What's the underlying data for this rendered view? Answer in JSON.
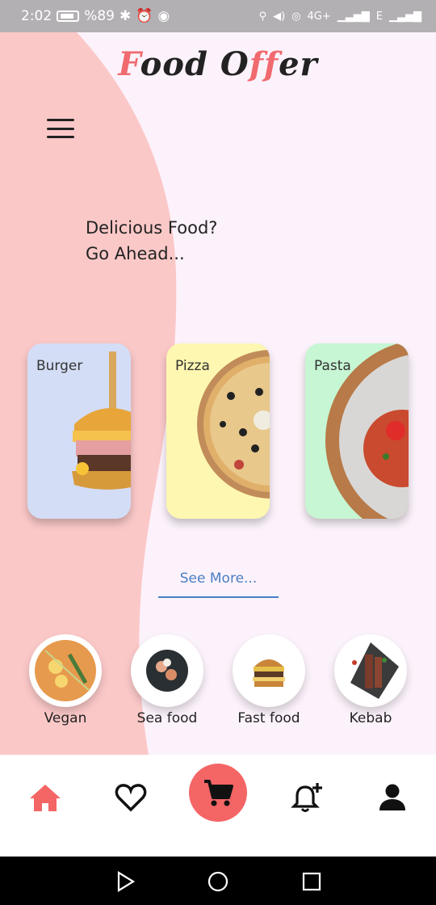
{
  "status_bar": {
    "time": "2:02",
    "battery": "%89",
    "network_label": "4G+",
    "signal2_label": "E"
  },
  "app": {
    "logo_part1": "F",
    "logo_part2": "ood O",
    "logo_part3": "ff",
    "logo_part4": "er",
    "brand_color": "#f06a6f"
  },
  "header": {
    "menu_icon": "hamburger-menu-icon"
  },
  "tagline": {
    "line1": "Delicious Food?",
    "line2": "Go Ahead..."
  },
  "food_cards": [
    {
      "label": "Burger",
      "bg_color": "#d3ddf6",
      "image": "burger-image"
    },
    {
      "label": "Pizza",
      "bg_color": "#fdf7b1",
      "image": "pizza-image"
    },
    {
      "label": "Pasta",
      "bg_color": "#c6f6d3",
      "image": "pasta-image"
    }
  ],
  "see_more_label": "See More...",
  "categories": [
    {
      "name": "Vegan",
      "image": "vegan-ramen-image"
    },
    {
      "name": "Sea food",
      "image": "seafood-image"
    },
    {
      "name": "Fast food",
      "image": "fastfood-burger-image"
    },
    {
      "name": "Kebab",
      "image": "kebab-image"
    }
  ],
  "bottom_nav": {
    "items": [
      "home-icon",
      "heart-icon",
      "cart-icon",
      "notification-add-icon",
      "profile-icon"
    ],
    "active_color": "#f46566"
  },
  "system_nav": [
    "back-icon",
    "home-circle-icon",
    "recents-icon"
  ]
}
